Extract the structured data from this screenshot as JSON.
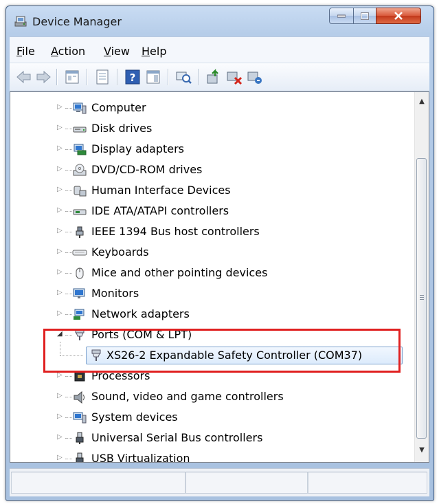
{
  "window": {
    "title": "Device Manager",
    "controls": [
      "minimize",
      "maximize",
      "close"
    ]
  },
  "menu": [
    {
      "key": "F",
      "rest": "ile"
    },
    {
      "key": "A",
      "rest": "ction"
    },
    {
      "key": "V",
      "rest": "iew"
    },
    {
      "key": "H",
      "rest": "elp"
    }
  ],
  "toolbar": {
    "buttons": [
      "back-icon",
      "forward-icon",
      "properties-icon",
      "properties-sheet-icon",
      "help-icon",
      "show-hide-pane-icon",
      "scan-hardware-icon",
      "update-driver-icon",
      "disable-device-icon",
      "uninstall-device-icon"
    ]
  },
  "tree": {
    "items": [
      {
        "label": "Computer",
        "icon": "computer-icon"
      },
      {
        "label": "Disk drives",
        "icon": "disk-drive-icon"
      },
      {
        "label": "Display adapters",
        "icon": "display-adapter-icon"
      },
      {
        "label": "DVD/CD-ROM drives",
        "icon": "dvd-drive-icon"
      },
      {
        "label": "Human Interface Devices",
        "icon": "hid-icon"
      },
      {
        "label": "IDE ATA/ATAPI controllers",
        "icon": "ide-controller-icon"
      },
      {
        "label": "IEEE 1394 Bus host controllers",
        "icon": "ieee1394-icon"
      },
      {
        "label": "Keyboards",
        "icon": "keyboard-icon"
      },
      {
        "label": "Mice and other pointing devices",
        "icon": "mouse-icon"
      },
      {
        "label": "Monitors",
        "icon": "monitor-icon"
      },
      {
        "label": "Network adapters",
        "icon": "network-adapter-icon"
      },
      {
        "label": "Ports (COM & LPT)",
        "icon": "port-icon",
        "expanded": true
      },
      {
        "label": "XS26-2 Expandable Safety Controller (COM37)",
        "icon": "port-icon",
        "child": true,
        "selected": true
      },
      {
        "label": "Processors",
        "icon": "processor-icon"
      },
      {
        "label": "Sound, video and game controllers",
        "icon": "sound-icon"
      },
      {
        "label": "System devices",
        "icon": "system-devices-icon"
      },
      {
        "label": "Universal Serial Bus controllers",
        "icon": "usb-icon"
      },
      {
        "label": "USB Virtualization",
        "icon": "usb-icon"
      }
    ]
  },
  "colors": {
    "highlight_box": "#e02020",
    "selection": "#dcebfc"
  }
}
